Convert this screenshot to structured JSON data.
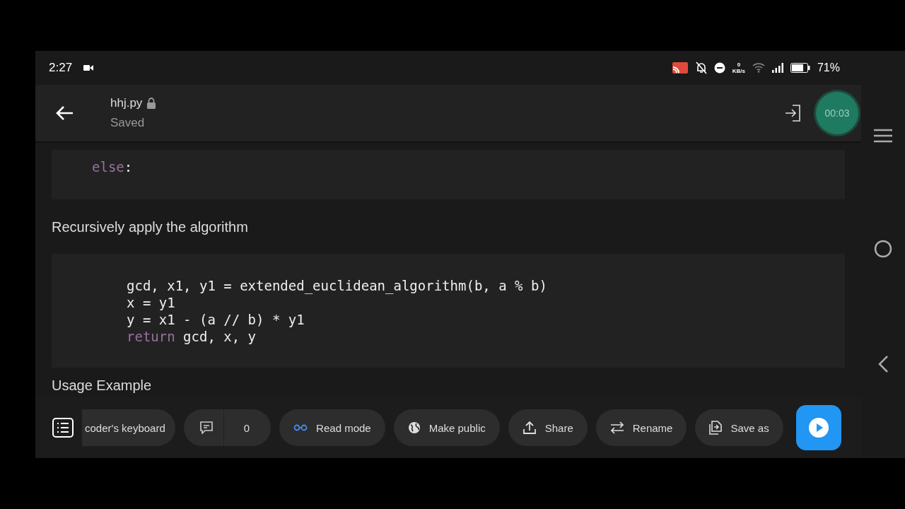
{
  "status_bar": {
    "time": "2:27",
    "net_speed_value": "0",
    "net_speed_unit": "KB/s",
    "battery": "71%"
  },
  "header": {
    "filename": "hhj.py",
    "status": "Saved",
    "recording": "00:03"
  },
  "content": [
    {
      "kind": "code",
      "lines": [
        [
          {
            "text": "else",
            "kind": "keyword"
          },
          {
            "text": ":",
            "kind": "plain"
          }
        ]
      ]
    },
    {
      "kind": "text",
      "text": "Recursively apply the algorithm"
    },
    {
      "kind": "code",
      "lines": [
        [
          {
            "text": "gcd, x1, y1 = extended_euclidean_algorithm(b, a % b)",
            "kind": "plain"
          }
        ],
        [
          {
            "text": "x = y1",
            "kind": "plain"
          }
        ],
        [
          {
            "text": "y = x1 - (a // b) * y1",
            "kind": "plain"
          }
        ],
        [
          {
            "text": "return",
            "kind": "keyword"
          },
          {
            "text": " gcd, x, y",
            "kind": "plain"
          }
        ]
      ]
    },
    {
      "kind": "text",
      "text": "Usage Example"
    }
  ],
  "toolbar": {
    "keyboard": "coder's keyboard",
    "comments": "0",
    "actions": [
      {
        "label": "Read mode"
      },
      {
        "label": "Make public"
      },
      {
        "label": "Share"
      },
      {
        "label": "Rename"
      },
      {
        "label": "Save as"
      }
    ]
  }
}
